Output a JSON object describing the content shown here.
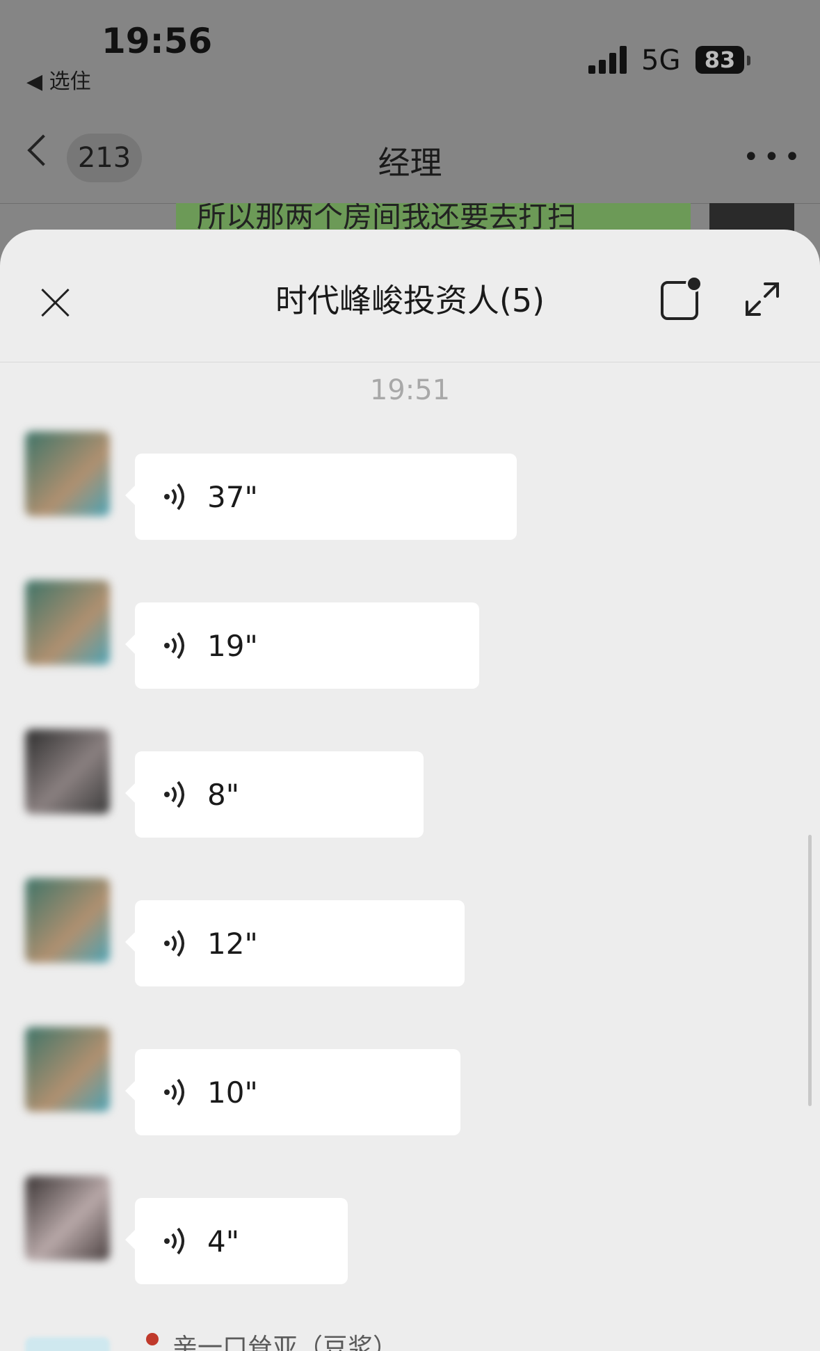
{
  "status_bar": {
    "time": "19:56",
    "back_app": "◀ 选住",
    "network": "5G",
    "battery": "83"
  },
  "nav": {
    "unread_count": "213",
    "title": "经理"
  },
  "background_message": "所以那两个房间我还要去打扫",
  "sheet": {
    "title": "时代峰峻投资人(5)",
    "timestamp": "19:51",
    "messages": [
      {
        "sender": "",
        "duration": "37\""
      },
      {
        "sender": "",
        "duration": "19\""
      },
      {
        "sender": "",
        "duration": "8\""
      },
      {
        "sender": "",
        "duration": "12\""
      },
      {
        "sender": "",
        "duration": "10\""
      },
      {
        "sender": "",
        "duration": "4\""
      }
    ],
    "last_sender": "亲一口耸亚（豆浆）"
  },
  "colors": {
    "sheet_bg": "#ededed",
    "bubble_bg": "#ffffff",
    "overlay": "#858585"
  }
}
